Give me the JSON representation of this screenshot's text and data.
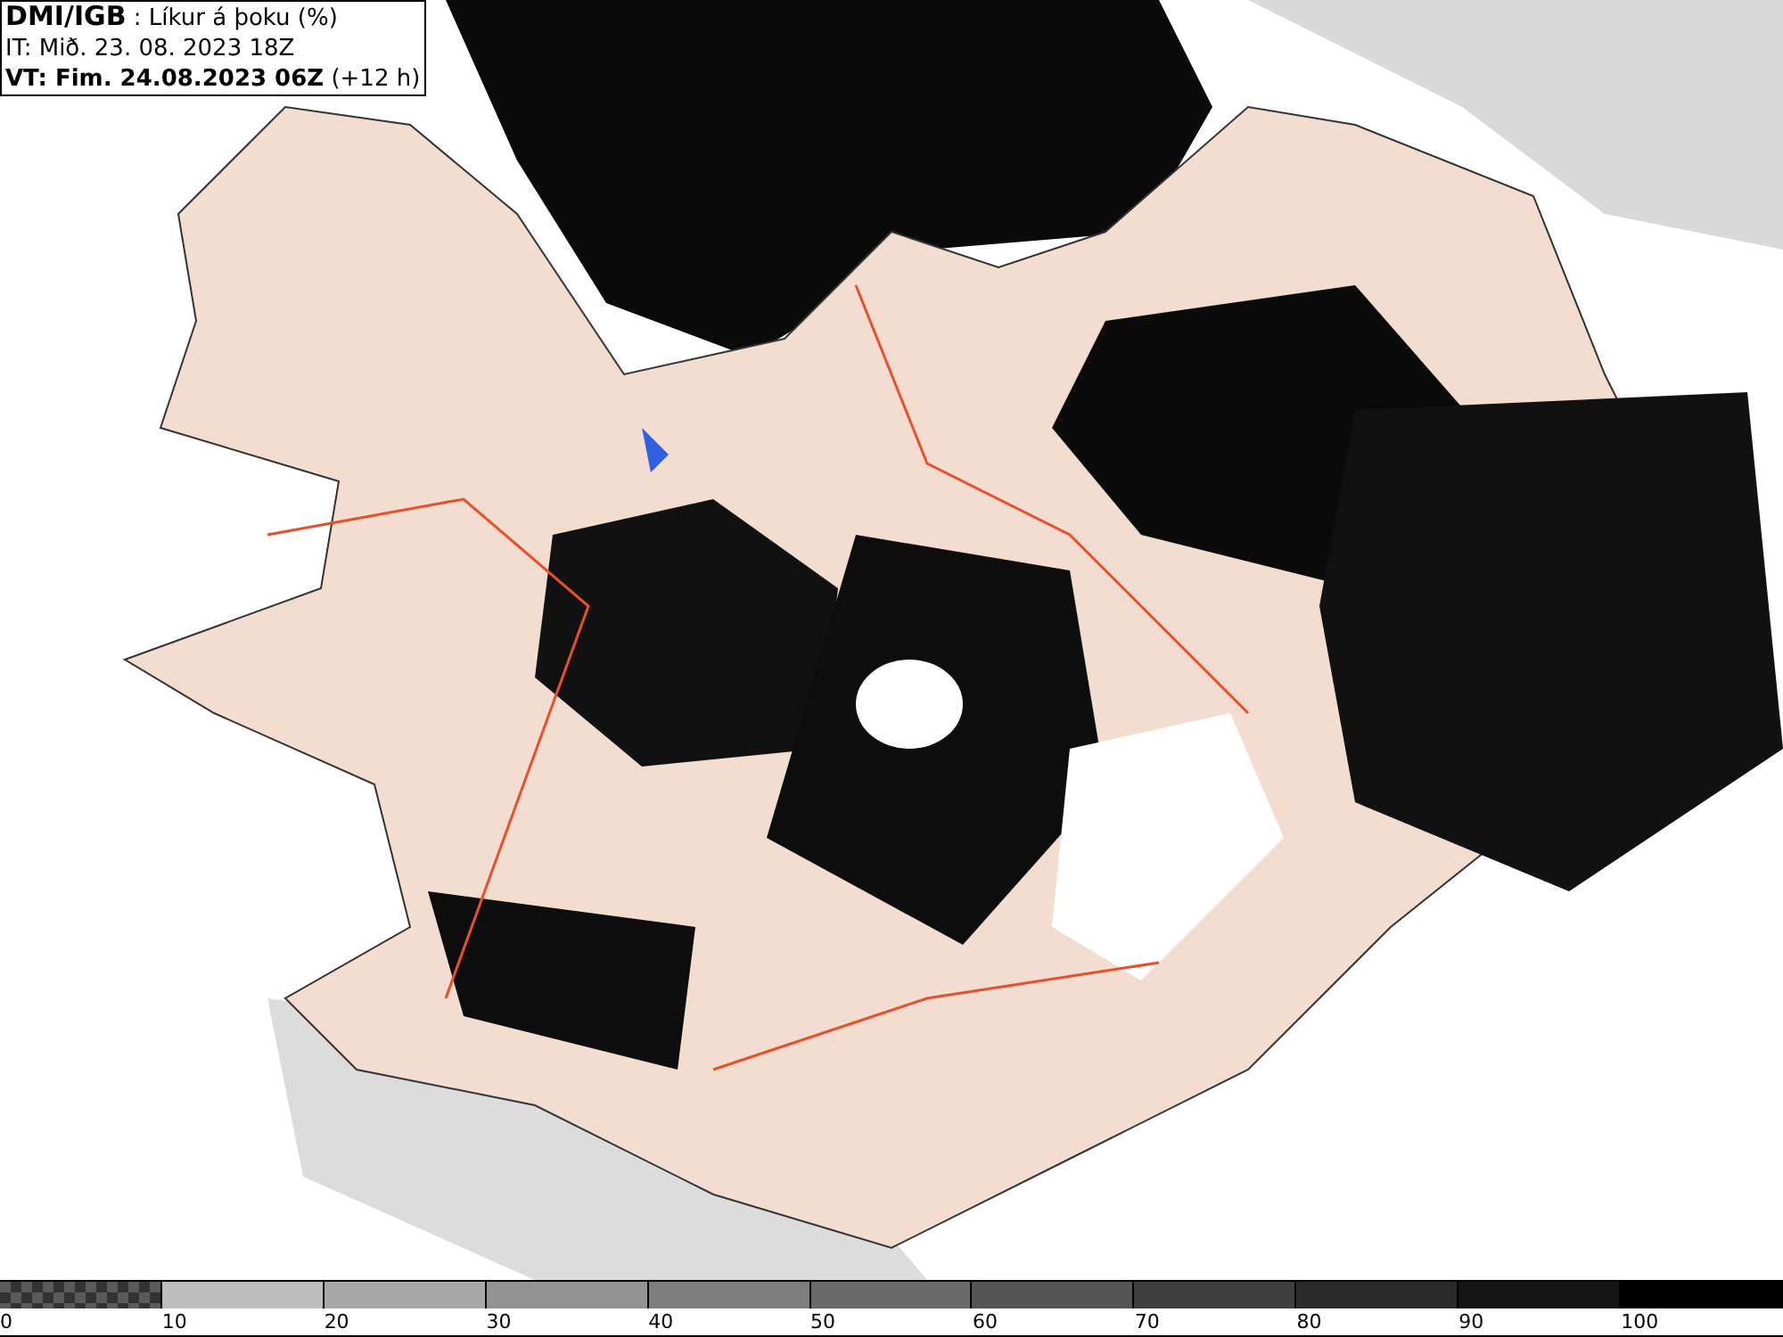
{
  "header": {
    "source": "DMI/IGB",
    "title": " : Líkur á þoku (%)",
    "initial_time": "IT: Mið. 23. 08. 2023 18Z",
    "valid_time": "VT: Fim. 24.08.2023 06Z",
    "offset": " (+12 h)"
  },
  "legend": [
    {
      "label": "0",
      "kind": "checker",
      "color": "#5a5a5a"
    },
    {
      "label": "10",
      "kind": "solid",
      "color": "#bdbdbd"
    },
    {
      "label": "20",
      "kind": "solid",
      "color": "#a8a8a8"
    },
    {
      "label": "30",
      "kind": "solid",
      "color": "#939393"
    },
    {
      "label": "40",
      "kind": "solid",
      "color": "#7e7e7e"
    },
    {
      "label": "50",
      "kind": "solid",
      "color": "#6a6a6a"
    },
    {
      "label": "60",
      "kind": "solid",
      "color": "#555555"
    },
    {
      "label": "70",
      "kind": "solid",
      "color": "#3f3f3f"
    },
    {
      "label": "80",
      "kind": "solid",
      "color": "#2a2a2a"
    },
    {
      "label": "90",
      "kind": "solid",
      "color": "#151515"
    },
    {
      "label": "100",
      "kind": "solid",
      "color": "#000000"
    }
  ]
}
